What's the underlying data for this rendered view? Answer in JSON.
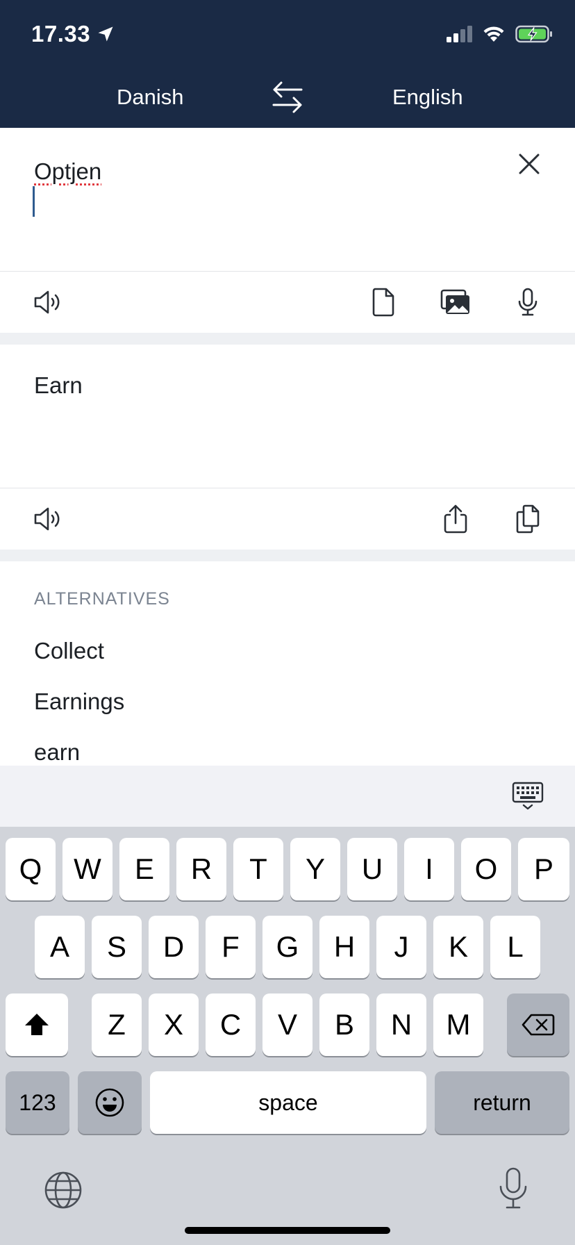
{
  "status": {
    "time": "17.33"
  },
  "header": {
    "source_lang": "Danish",
    "target_lang": "English"
  },
  "source": {
    "text": "Optjen"
  },
  "translation": {
    "text": "Earn"
  },
  "alternatives": {
    "heading": "ALTERNATIVES",
    "items": [
      "Collect",
      "Earnings",
      "earn"
    ]
  },
  "icons": {
    "location": "location-arrow-icon",
    "signal": "cellular-signal-icon",
    "wifi": "wifi-icon",
    "battery": "battery-charging-icon",
    "swap": "swap-languages-icon",
    "clear": "close-icon",
    "speaker": "speaker-icon",
    "document": "document-icon",
    "image": "image-icon",
    "mic": "microphone-icon",
    "share": "share-icon",
    "copy": "copy-icon",
    "keyboard_hide": "keyboard-dismiss-icon",
    "globe": "globe-icon",
    "dictation": "microphone-icon"
  },
  "keyboard": {
    "row1": [
      "Q",
      "W",
      "E",
      "R",
      "T",
      "Y",
      "U",
      "I",
      "O",
      "P"
    ],
    "row2": [
      "A",
      "S",
      "D",
      "F",
      "G",
      "H",
      "J",
      "K",
      "L"
    ],
    "row3": [
      "Z",
      "X",
      "C",
      "V",
      "B",
      "N",
      "M"
    ],
    "numbers_label": "123",
    "space_label": "space",
    "return_label": "return"
  },
  "colors": {
    "header_bg": "#1a2a45",
    "battery_charge": "#5fd25a",
    "spell_underline": "#e0393e",
    "caret": "#2f5b8f"
  }
}
